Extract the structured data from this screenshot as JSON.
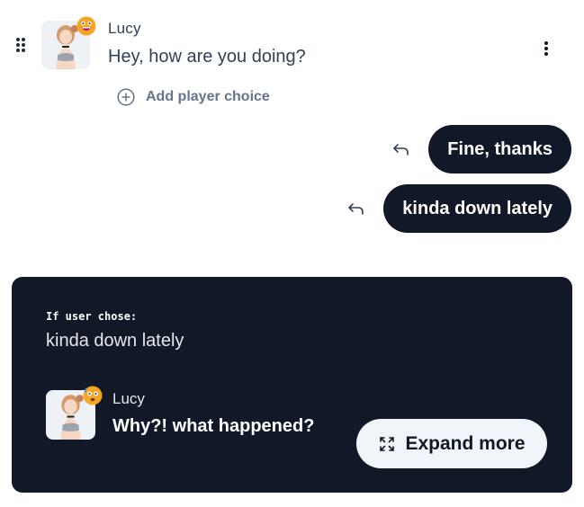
{
  "message": {
    "speaker": "Lucy",
    "text": "Hey, how are you doing?",
    "emotion_icon": "grinning-face-icon",
    "add_choice_label": "Add player choice"
  },
  "choices": [
    {
      "label": "Fine, thanks",
      "icon": "reply-arrow-icon"
    },
    {
      "label": "kinda down lately",
      "icon": "reply-arrow-icon"
    }
  ],
  "branch": {
    "condition_label": "If user chose:",
    "chosen_option": "kinda down lately",
    "speaker": "Lucy",
    "text": "Why?! what happened?",
    "emotion_icon": "anxious-sweat-face-icon",
    "expand_label": "Expand more"
  },
  "colors": {
    "pill_bg": "#111827",
    "card_bg": "#111827",
    "expand_bg": "#f1f5f9",
    "muted_text": "#64748b"
  }
}
